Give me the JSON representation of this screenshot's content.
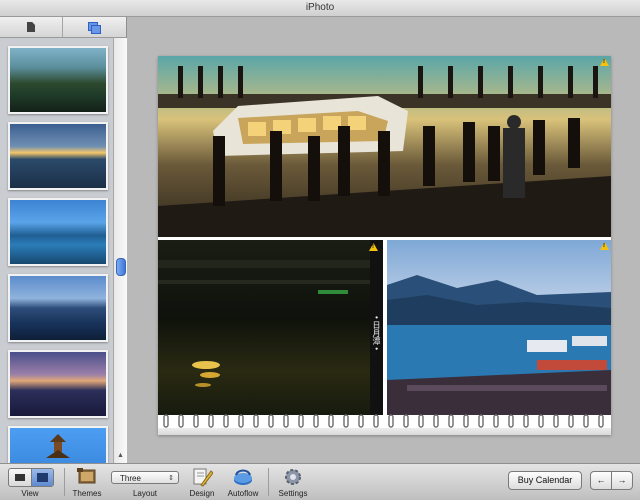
{
  "window": {
    "title": "iPhoto"
  },
  "sidebar": {
    "tabs": [
      {
        "icon": "document-icon"
      },
      {
        "icon": "pages-icon"
      }
    ],
    "thumbnails": [
      {
        "name": "page-1"
      },
      {
        "name": "page-2"
      },
      {
        "name": "page-3"
      },
      {
        "name": "page-4"
      },
      {
        "name": "page-5"
      },
      {
        "name": "page-6"
      }
    ]
  },
  "page": {
    "vertical_caption": "• 日月潭 •"
  },
  "toolbar": {
    "view_label": "View",
    "themes_label": "Themes",
    "layout_label": "Layout",
    "layout_value": "Three",
    "design_label": "Design",
    "autoflow_label": "Autoflow",
    "settings_label": "Settings",
    "buy_calendar_label": "Buy Calendar",
    "prev_arrow": "←",
    "next_arrow": "→"
  },
  "colors": {
    "accent": "#3f78d8",
    "warning": "#f4c20d"
  }
}
